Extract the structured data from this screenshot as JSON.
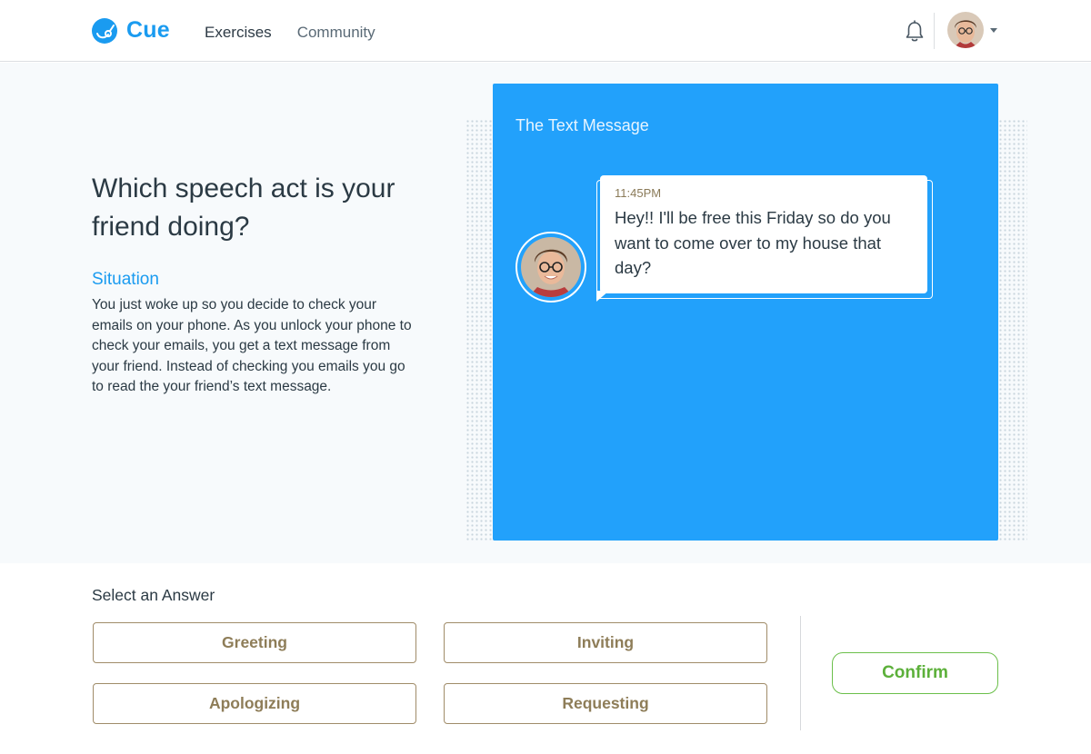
{
  "header": {
    "app_name": "Cue",
    "nav": [
      {
        "label": "Exercises"
      },
      {
        "label": "Community"
      }
    ],
    "icons": {
      "logo": "cue-logo-icon",
      "bell": "bell-icon",
      "caret": "caret-down-icon"
    }
  },
  "main": {
    "question": "Which speech act is your friend doing?",
    "situation_title": "Situation",
    "situation_text": "You just woke up so you decide to check your emails on your phone. As you unlock your phone to check your emails, you get a text message from your friend. Instead of checking you emails you go to read the your friend’s text message.",
    "panel": {
      "title": "The Text Message",
      "message": {
        "time": "11:45PM",
        "text": "Hey!! I'll be free this Friday so do you want to come over to my house that day?"
      }
    }
  },
  "answers": {
    "label": "Select an Answer",
    "options": [
      {
        "label": "Greeting"
      },
      {
        "label": "Inviting"
      },
      {
        "label": "Apologizing"
      },
      {
        "label": "Requesting"
      }
    ],
    "confirm_label": "Confirm"
  },
  "colors": {
    "brand": "#1a9bf0",
    "panel": "#22a1fb",
    "answer_text": "#8e7d58",
    "confirm": "#5cb03a"
  }
}
